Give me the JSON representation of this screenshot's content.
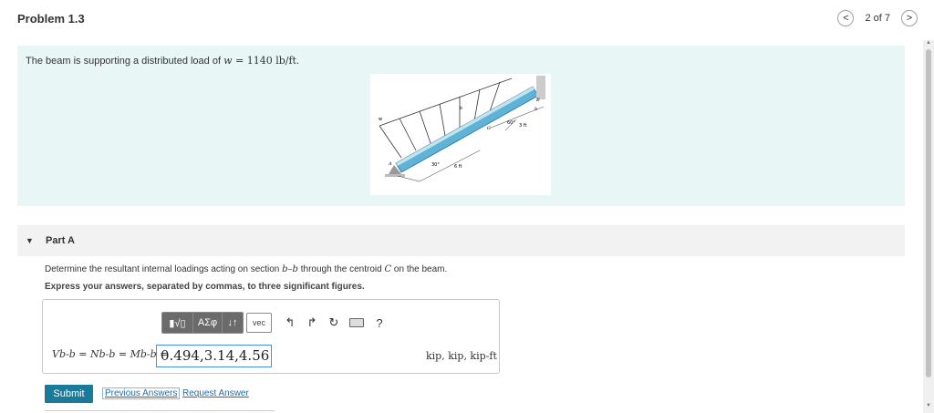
{
  "header": {
    "title": "Problem 1.3",
    "page_indicator": "2 of 7",
    "prev_glyph": "<",
    "next_glyph": ">"
  },
  "intro": {
    "text_before": "The beam is supporting a distributed load of ",
    "w_symbol": "w",
    "equals": " = ",
    "w_value": "1140 lb/ft",
    "text_after": ".",
    "figure_labels": {
      "w": "w",
      "b_top": "b",
      "b_right": "b",
      "B": "B",
      "A": "A",
      "C": "C",
      "angle_60": "60°",
      "dim_3ft": "3 ft",
      "angle_30": "30°",
      "dim_6ft": "6 ft"
    }
  },
  "part_a": {
    "label": "Part A",
    "question_before": "Determine the resultant internal loadings acting on section ",
    "section": "b–b",
    "question_mid": " through the centroid ",
    "centroid": "C",
    "question_after": " on the beam.",
    "instruction": "Express your answers, separated by commas, to three significant figures.",
    "toolbar": {
      "templates_glyph": "▮√▯",
      "greek_glyph": "ΑΣφ",
      "sort_glyph": "↓↑",
      "vec_label": "vec",
      "undo_glyph": "↰",
      "redo_glyph": "↱",
      "reset_glyph": "↻",
      "help_glyph": "?"
    },
    "expression_label": "Vb-b = Nb-b = Mb-b =",
    "answer_value": "0.494,3.14,4.56",
    "units": "kip, kip, kip-ft"
  },
  "actions": {
    "submit_label": "Submit",
    "previous_answers_label": "Previous Answers",
    "request_answer_label": "Request Answer"
  },
  "icons": {
    "prev": "chevron-left-icon",
    "next": "chevron-right-icon",
    "collapse": "caret-down-icon"
  },
  "colors": {
    "intro_bg": "#e8f6f6",
    "submit_bg": "#1a7a99",
    "link": "#1a6fb0",
    "toolbar_btn": "#6b6b6b",
    "beam": "#5fb3d6"
  }
}
